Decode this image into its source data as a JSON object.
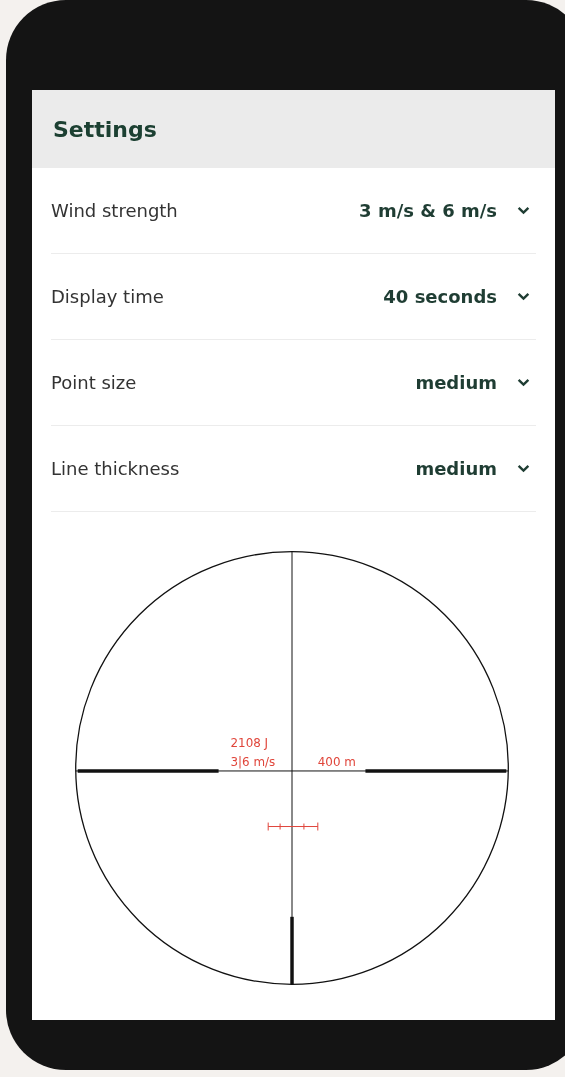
{
  "header": {
    "title": "Settings"
  },
  "settings": [
    {
      "label": "Wind strength",
      "value": "3 m/s & 6 m/s"
    },
    {
      "label": "Display time",
      "value": "40 seconds"
    },
    {
      "label": "Point size",
      "value": "medium"
    },
    {
      "label": "Line thickness",
      "value": "medium"
    }
  ],
  "reticle": {
    "energy": "2108 J",
    "wind": "3|6 m/s",
    "distance": "400 m"
  }
}
